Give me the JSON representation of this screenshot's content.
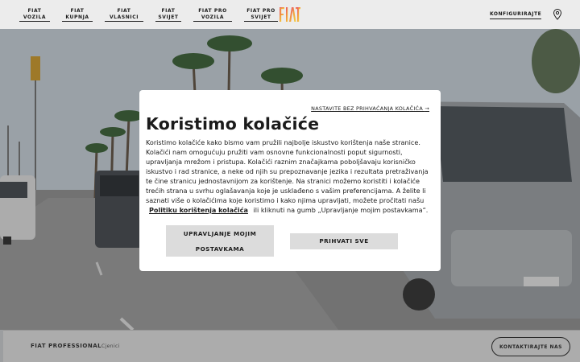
{
  "header": {
    "nav": [
      {
        "line1": "FIAT",
        "line2": "VOZILA"
      },
      {
        "line1": "FIAT",
        "line2": "KUPNJA"
      },
      {
        "line1": "FIAT",
        "line2": "VLASNICI"
      },
      {
        "line1": "FIAT",
        "line2": "SVIJET"
      },
      {
        "line1": "FIAT PRO",
        "line2": "VOZILA"
      },
      {
        "line1": "FIAT PRO",
        "line2": "SVIJET"
      }
    ],
    "logo_text": "FIAT",
    "configure_label": "KONFIGURIRAJTE",
    "location_icon": "map-pin-icon"
  },
  "bottom_bar": {
    "brand": "FIAT PROFESSIONAL",
    "link": "Cjenici",
    "contact_label": "KONTAKTIRAJTE NAS"
  },
  "cookie_modal": {
    "skip_label": "NASTAVITE BEZ PRIHVAĆANJA KOLAČIĆA",
    "title": "Koristimo kolačiće",
    "body": "Koristimo kolačiće kako bismo vam pružili najbolje iskustvo korištenja naše stranice. Kolačići nam omogućuju pružiti vam osnovne funkcionalnosti poput sigurnosti, upravljanja mrežom i pristupa. Kolačići raznim značajkama poboljšavaju korisničko iskustvo i rad stranice, a neke od njih su prepoznavanje jezika i rezultata pretraživanja te čine stranicu jednostavnijom za korištenje. Na stranici možemo koristiti i kolačiće trećih strana u svrhu oglašavanja koje je usklađeno s vašim preferencijama. A želite li saznati više o kolačićima koje koristimo i kako njima upravljati, možete pročitati našu",
    "policy_link": "Politiku korištenja kolačića",
    "body_end": "ili kliknuti na gumb „Upravljanje mojim postavkama“.",
    "manage_line1": "UPRAVLJANJE MOJIM",
    "manage_line2": "POSTAVKAMA",
    "accept_label": "PRIHVATI SVE"
  },
  "colors": {
    "logo_gradient": [
      "#e9407a",
      "#f2a33a",
      "#f5d44a"
    ],
    "modal_bg": "#ffffff",
    "button_bg": "#dcdcdc"
  }
}
